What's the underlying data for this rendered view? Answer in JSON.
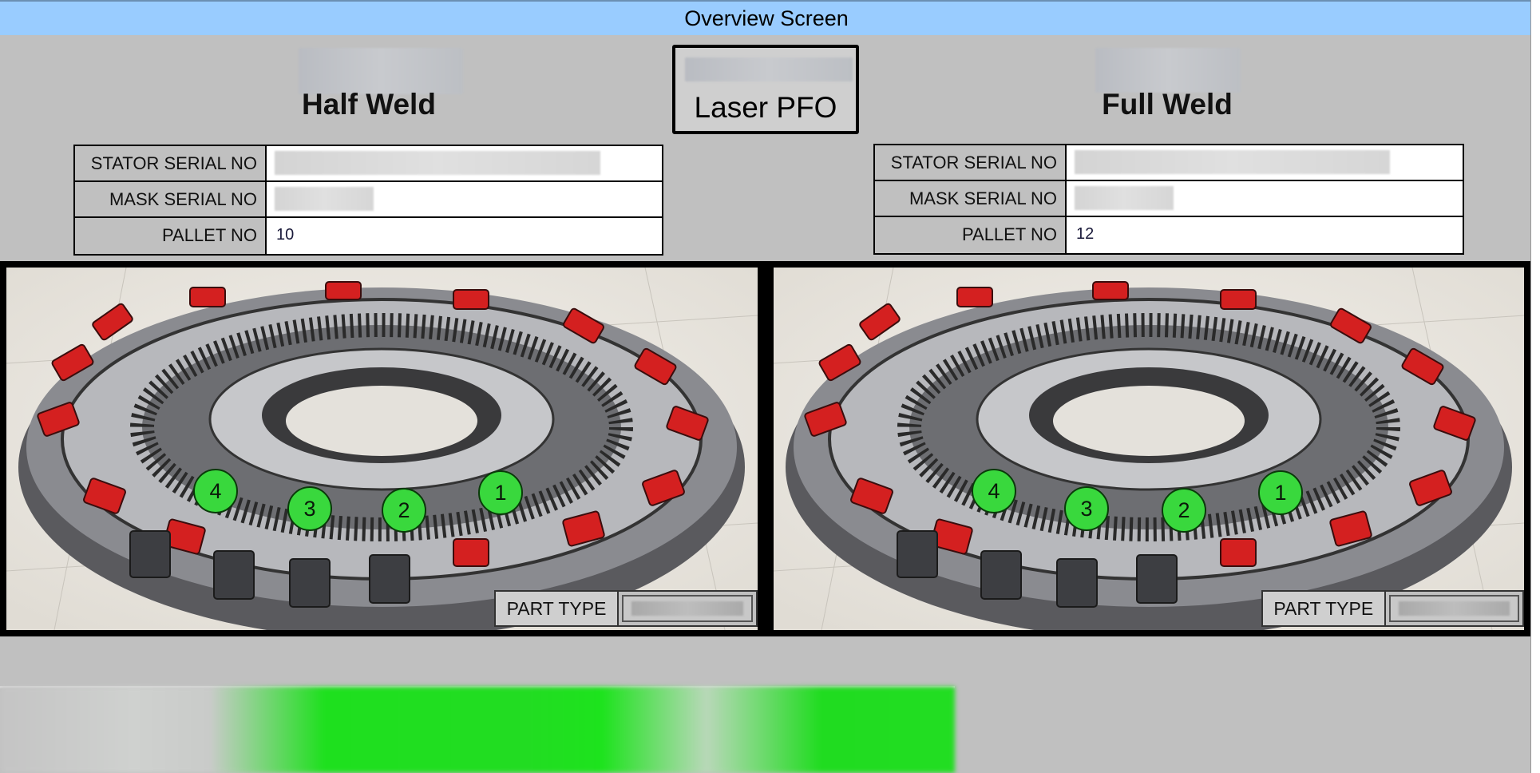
{
  "window": {
    "title": "Overview Screen"
  },
  "stations": {
    "left": {
      "title": "Half Weld"
    },
    "center": {
      "title": "Laser PFO"
    },
    "right": {
      "title": "Full Weld"
    }
  },
  "left_info": {
    "rows": [
      {
        "label": "STATOR SERIAL NO",
        "value": ""
      },
      {
        "label": "MASK SERIAL NO",
        "value": ""
      },
      {
        "label": "PALLET NO",
        "value": "10"
      }
    ]
  },
  "right_info": {
    "rows": [
      {
        "label": "STATOR SERIAL NO",
        "value": ""
      },
      {
        "label": "MASK SERIAL NO",
        "value": ""
      },
      {
        "label": "PALLET NO",
        "value": "12"
      }
    ]
  },
  "left_panel": {
    "markers": [
      "1",
      "2",
      "3",
      "4"
    ],
    "part_type_label": "PART TYPE",
    "part_type_value": ""
  },
  "right_panel": {
    "markers": [
      "1",
      "2",
      "3",
      "4"
    ],
    "part_type_label": "PART TYPE",
    "part_type_value": ""
  },
  "colors": {
    "title_bar": "#99ccff",
    "background": "#c0c0c0",
    "marker_green": "#39d83d",
    "status_green": "#22dd22",
    "winding_red": "#d42020"
  }
}
